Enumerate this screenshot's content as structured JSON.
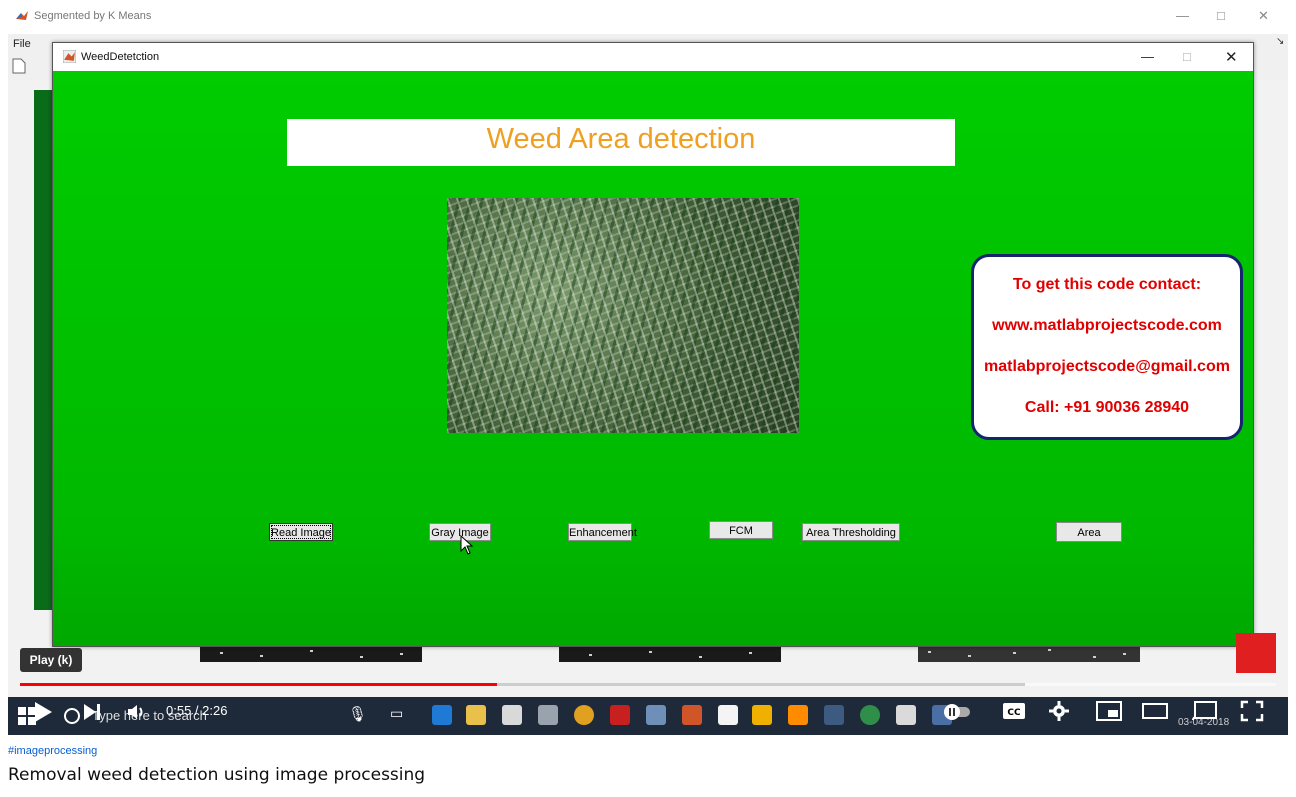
{
  "background_window": {
    "title": "Segmented by K Means",
    "menu_file": "File",
    "minimize": "—",
    "maximize": "□",
    "close": "✕"
  },
  "app_window": {
    "title": "WeedDetetction",
    "minimize": "—",
    "maximize": "□",
    "close": "✕",
    "heading": "Weed Area detection",
    "contact": {
      "line1": "To get this code contact:",
      "line2": "www.matlabprojectscode.com",
      "line3": "matlabprojectscode@gmail.com",
      "line4": "Call: +91 90036 28940"
    },
    "buttons": {
      "read_image": "Read Image",
      "gray_image": "Gray Image",
      "enhancement": "Enhancement",
      "fcm": "FCM",
      "area_thresholding": "Area Thresholding",
      "area": "Area"
    }
  },
  "player": {
    "play_tooltip": "Play (k)",
    "time": "0:55 / 2:26",
    "progress_fraction": 0.38,
    "buffered_fraction": 0.8
  },
  "taskbar": {
    "search_placeholder": "Type here to search",
    "date": "03-04-2018"
  },
  "video": {
    "hashtag": "#imageprocessing",
    "title": "Removal weed detection using image processing"
  }
}
